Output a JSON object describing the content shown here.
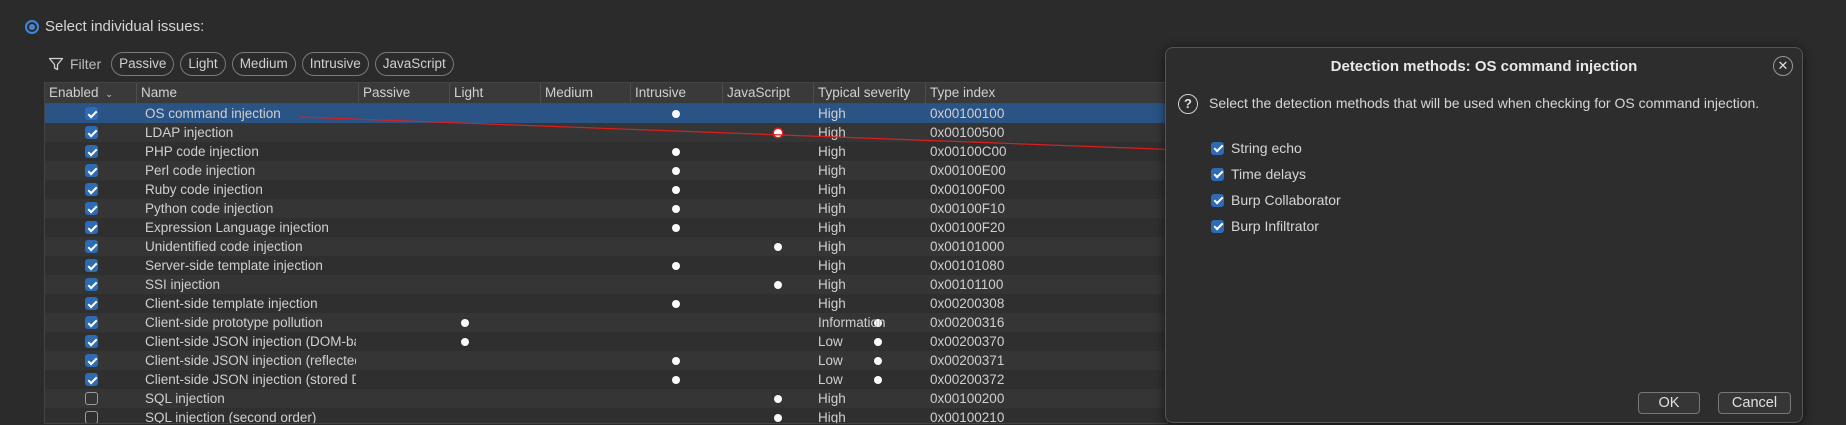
{
  "selection": {
    "radio_label": "Select individual issues:"
  },
  "filter": {
    "label": "Filter",
    "chips": [
      "Passive",
      "Light",
      "Medium",
      "Intrusive",
      "JavaScript"
    ]
  },
  "table": {
    "columns": [
      "Enabled",
      "Name",
      "Passive",
      "Light",
      "Medium",
      "Intrusive",
      "JavaScript",
      "Typical severity",
      "Type index"
    ],
    "sort_indicator": "chevron-down-icon",
    "rows": [
      {
        "enabled": true,
        "name": "OS command injection",
        "passive": false,
        "light": false,
        "medium": true,
        "intrusive": false,
        "javascript": false,
        "severity": "High",
        "type_index": "0x00100100",
        "selected": true
      },
      {
        "enabled": true,
        "name": "LDAP injection",
        "passive": false,
        "light": false,
        "medium": false,
        "intrusive": true,
        "javascript": false,
        "severity": "High",
        "type_index": "0x00100500"
      },
      {
        "enabled": true,
        "name": "PHP code injection",
        "passive": false,
        "light": false,
        "medium": true,
        "intrusive": false,
        "javascript": false,
        "severity": "High",
        "type_index": "0x00100C00"
      },
      {
        "enabled": true,
        "name": "Perl code injection",
        "passive": false,
        "light": false,
        "medium": true,
        "intrusive": false,
        "javascript": false,
        "severity": "High",
        "type_index": "0x00100E00"
      },
      {
        "enabled": true,
        "name": "Ruby code injection",
        "passive": false,
        "light": false,
        "medium": true,
        "intrusive": false,
        "javascript": false,
        "severity": "High",
        "type_index": "0x00100F00"
      },
      {
        "enabled": true,
        "name": "Python code injection",
        "passive": false,
        "light": false,
        "medium": true,
        "intrusive": false,
        "javascript": false,
        "severity": "High",
        "type_index": "0x00100F10"
      },
      {
        "enabled": true,
        "name": "Expression Language injection",
        "passive": false,
        "light": false,
        "medium": true,
        "intrusive": false,
        "javascript": false,
        "severity": "High",
        "type_index": "0x00100F20"
      },
      {
        "enabled": true,
        "name": "Unidentified code injection",
        "passive": false,
        "light": false,
        "medium": false,
        "intrusive": true,
        "javascript": false,
        "severity": "High",
        "type_index": "0x00101000"
      },
      {
        "enabled": true,
        "name": "Server-side template injection",
        "passive": false,
        "light": false,
        "medium": true,
        "intrusive": false,
        "javascript": false,
        "severity": "High",
        "type_index": "0x00101080"
      },
      {
        "enabled": true,
        "name": "SSI injection",
        "passive": false,
        "light": false,
        "medium": false,
        "intrusive": true,
        "javascript": false,
        "severity": "High",
        "type_index": "0x00101100"
      },
      {
        "enabled": true,
        "name": "Client-side template injection",
        "passive": false,
        "light": false,
        "medium": true,
        "intrusive": false,
        "javascript": false,
        "severity": "High",
        "type_index": "0x00200308"
      },
      {
        "enabled": true,
        "name": "Client-side prototype pollution",
        "passive": true,
        "light": false,
        "medium": false,
        "intrusive": false,
        "javascript": true,
        "severity": "Information",
        "type_index": "0x00200316"
      },
      {
        "enabled": true,
        "name": "Client-side JSON injection (DOM-based)",
        "passive": true,
        "light": false,
        "medium": false,
        "intrusive": false,
        "javascript": true,
        "severity": "Low",
        "type_index": "0x00200370"
      },
      {
        "enabled": true,
        "name": "Client-side JSON injection (reflected D...",
        "passive": false,
        "light": false,
        "medium": true,
        "intrusive": false,
        "javascript": true,
        "severity": "Low",
        "type_index": "0x00200371"
      },
      {
        "enabled": true,
        "name": "Client-side JSON injection (stored DO...",
        "passive": false,
        "light": false,
        "medium": true,
        "intrusive": false,
        "javascript": true,
        "severity": "Low",
        "type_index": "0x00200372"
      },
      {
        "enabled": false,
        "name": "SQL injection",
        "passive": false,
        "light": false,
        "medium": false,
        "intrusive": true,
        "javascript": false,
        "severity": "High",
        "type_index": "0x00100200"
      },
      {
        "enabled": false,
        "name": "SQL injection (second order)",
        "passive": false,
        "light": false,
        "medium": false,
        "intrusive": true,
        "javascript": false,
        "severity": "High",
        "type_index": "0x00100210"
      }
    ]
  },
  "dialog": {
    "title": "Detection methods: OS command injection",
    "close_icon": "close-icon",
    "help_icon": "help-icon",
    "description": "Select the detection methods that will be used when checking for OS command injection.",
    "options": [
      {
        "label": "String echo",
        "checked": true
      },
      {
        "label": "Time delays",
        "checked": true
      },
      {
        "label": "Burp Collaborator",
        "checked": true
      },
      {
        "label": "Burp Infiltrator",
        "checked": true
      }
    ],
    "ok_label": "OK",
    "cancel_label": "Cancel"
  },
  "colors": {
    "background": "#2b2b2b",
    "selected_row": "#2a5486",
    "checkbox_accent": "#2d6bb5",
    "annotation_arrow": "#d82020"
  }
}
